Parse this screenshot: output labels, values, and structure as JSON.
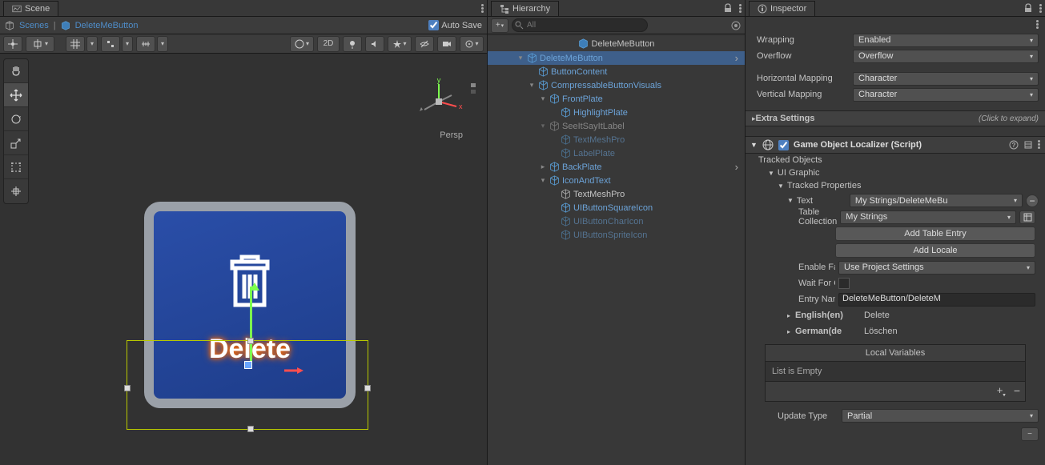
{
  "scene": {
    "tab_label": "Scene",
    "breadcrumb_root": "Scenes",
    "breadcrumb_current": "DeleteMeButton",
    "auto_save_label": "Auto Save",
    "mode_2d": "2D",
    "persp_label": "Persp",
    "gizmo": {
      "x": "x",
      "y": "y"
    },
    "preview_text": "Delete"
  },
  "hierarchy": {
    "tab_label": "Hierarchy",
    "search_placeholder": "All",
    "scene_name": "DeleteMeButton",
    "nodes": [
      {
        "label": "DeleteMeButton",
        "indent": 1,
        "fold": "▾",
        "blue": true,
        "sel": true
      },
      {
        "label": "ButtonContent",
        "indent": 2,
        "fold": "",
        "blue": true
      },
      {
        "label": "CompressableButtonVisuals",
        "indent": 2,
        "fold": "▾",
        "blue": true
      },
      {
        "label": "FrontPlate",
        "indent": 3,
        "fold": "▾",
        "blue": true
      },
      {
        "label": "HighlightPlate",
        "indent": 4,
        "fold": "",
        "blue": true
      },
      {
        "label": "SeeItSayItLabel",
        "indent": 3,
        "fold": "▾",
        "blue": false,
        "faded": true
      },
      {
        "label": "TextMeshPro",
        "indent": 4,
        "fold": "",
        "blue": true,
        "faded": true
      },
      {
        "label": "LabelPlate",
        "indent": 4,
        "fold": "",
        "blue": true,
        "faded": true
      },
      {
        "label": "BackPlate",
        "indent": 3,
        "fold": "▸",
        "blue": true
      },
      {
        "label": "IconAndText",
        "indent": 3,
        "fold": "▾",
        "blue": true
      },
      {
        "label": "TextMeshPro",
        "indent": 4,
        "fold": "",
        "blue": false
      },
      {
        "label": "UIButtonSquareIcon",
        "indent": 4,
        "fold": "",
        "blue": true
      },
      {
        "label": "UIButtonCharIcon",
        "indent": 4,
        "fold": "",
        "blue": true,
        "faded": true
      },
      {
        "label": "UIButtonSpriteIcon",
        "indent": 4,
        "fold": "",
        "blue": true,
        "faded": true
      }
    ]
  },
  "inspector": {
    "tab_label": "Inspector",
    "wrapping_label": "Wrapping",
    "wrapping_value": "Enabled",
    "overflow_label": "Overflow",
    "overflow_value": "Overflow",
    "hmap_label": "Horizontal Mapping",
    "hmap_value": "Character",
    "vmap_label": "Vertical Mapping",
    "vmap_value": "Character",
    "extra_settings": "Extra Settings",
    "click_expand": "(Click to expand)",
    "component_title": "Game Object Localizer (Script)",
    "tracked_objects": "Tracked Objects",
    "ui_graphic": "UI Graphic",
    "tracked_properties": "Tracked Properties",
    "text_label": "Text",
    "text_value": "My Strings/DeleteMeBu",
    "table_col_label": "Table Collection",
    "table_col_value": "My Strings",
    "add_table_entry": "Add Table Entry",
    "add_locale": "Add Locale",
    "enable_fallback_label": "Enable Fallback",
    "enable_fallback_value": "Use Project Settings",
    "wait_comp_label": "Wait For Completion",
    "entry_name_label": "Entry Name",
    "entry_name_value": "DeleteMeButton/DeleteM",
    "locale_en_label": "English(en)",
    "locale_en_value": "Delete",
    "locale_de_label": "German(de",
    "locale_de_value": "Löschen",
    "local_vars_header": "Local Variables",
    "local_vars_empty": "List is Empty",
    "update_type_label": "Update Type",
    "update_type_value": "Partial"
  }
}
